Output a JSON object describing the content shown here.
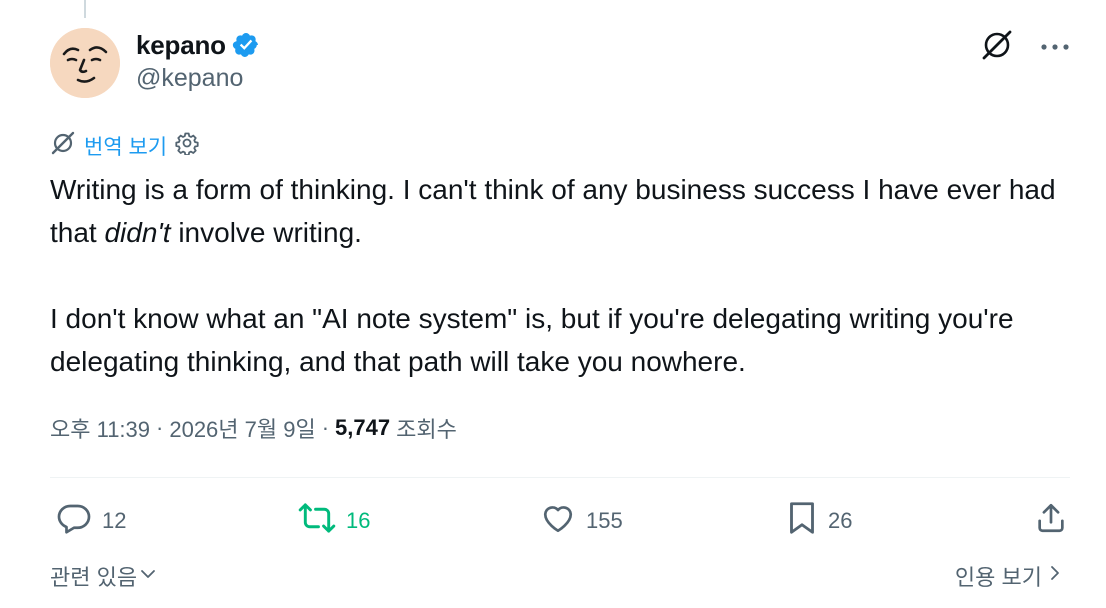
{
  "tweet": {
    "author": {
      "display_name": "kepano",
      "handle": "@kepano",
      "verified": true,
      "avatar_bg": "#f6d8bf"
    },
    "top_actions": {
      "grok_icon": "grok-icon",
      "more_icon": "more-icon"
    },
    "translate": {
      "label": "번역 보기",
      "icon": "grok-icon",
      "settings_icon": "gear-icon"
    },
    "text": {
      "p1_before": "Writing is a form of thinking. I can't think of any business success I have ever had that ",
      "p1_em": "didn't",
      "p1_after": " involve writing.",
      "p2": "I don't know what an \"AI note system\" is, but if you're delegating writing you're delegating thinking, and that path will take you nowhere."
    },
    "meta": {
      "time": "오후 11:39",
      "separator": "·",
      "date": "2026년 7월 9일",
      "views_count": "5,747",
      "views_label": "조회수"
    },
    "stats": {
      "replies": "12",
      "retweets": "16",
      "likes": "155",
      "bookmarks": "26"
    },
    "footer": {
      "related": "관련 있음",
      "quotes": "인용 보기"
    },
    "colors": {
      "accent": "#1d9bf0",
      "retweet_green": "#00ba7c",
      "muted": "#536471",
      "text": "#0f1419"
    }
  }
}
